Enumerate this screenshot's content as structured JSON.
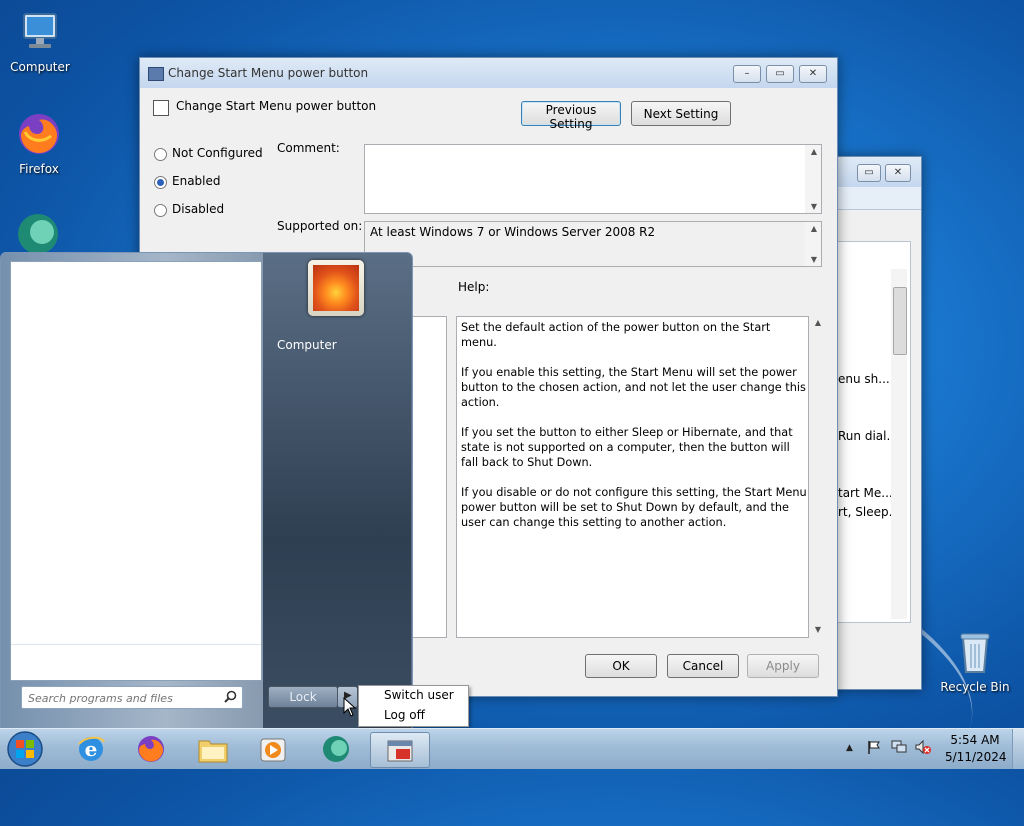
{
  "desktop": {
    "icons": [
      {
        "label": "Computer"
      },
      {
        "label": "Firefox"
      },
      {
        "label": "Recycle Bin"
      }
    ]
  },
  "policy_window": {
    "title": "Change Start Menu power button",
    "heading": "Change Start Menu power button",
    "previous_label": "Previous Setting",
    "next_label": "Next Setting",
    "options": [
      "Not Configured",
      "Enabled",
      "Disabled"
    ],
    "selected_option": "Enabled",
    "comment_label": "Comment:",
    "comment_value": "",
    "supported_label": "Supported on:",
    "supported_value": "At least Windows 7 or Windows Server 2008 R2",
    "help_label": "Help:",
    "help_paragraphs": [
      "Set the default action of the power button on the Start menu.",
      "If you enable this setting, the Start Menu will set the power button to the chosen action, and not let the user change this action.",
      "If you set the button to either Sleep or Hibernate, and that state is not supported on a computer, then the button will fall back to Shut Down.",
      "If you disable or do not configure this setting, the Start Menu power button will be set to Shut Down by default, and the user can change this setting to another action."
    ],
    "ok_label": "OK",
    "cancel_label": "Cancel",
    "apply_label": "Apply"
  },
  "background_window": {
    "visible_texts": [
      "enu sh...",
      "Run dial...",
      "tart Me...",
      "rt, Sleep..."
    ]
  },
  "start_menu": {
    "user_label": "Computer",
    "search_placeholder": "Search programs and files",
    "lock_label": "Lock",
    "context_menu": [
      "Switch user",
      "Log off"
    ]
  },
  "tray": {
    "time": "5:54 AM",
    "date": "5/11/2024"
  },
  "colors": {
    "accent": "#2b62b8",
    "desktop": "#1a78cf"
  }
}
